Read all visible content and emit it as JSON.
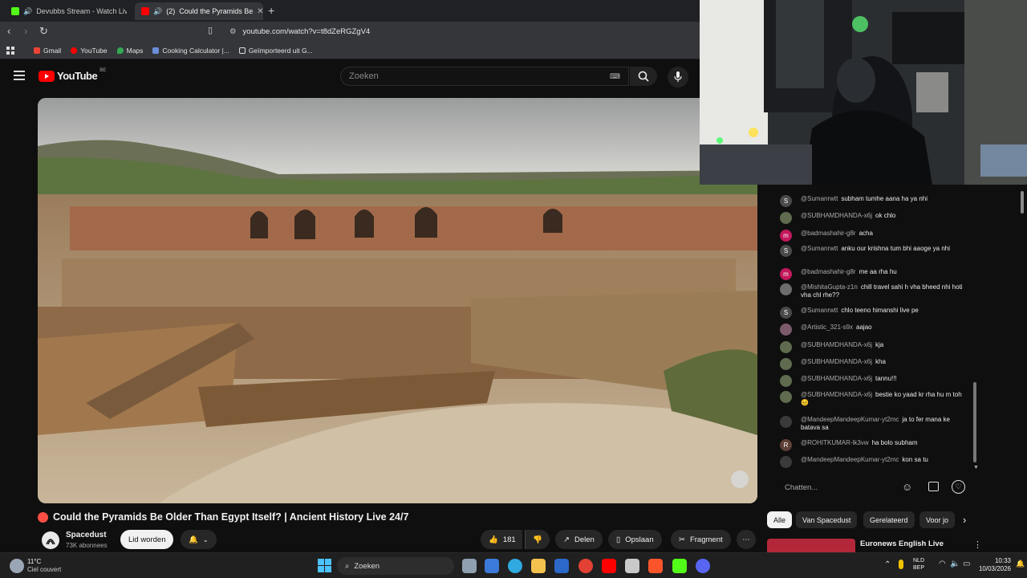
{
  "browser": {
    "tabs": [
      {
        "label": "Devubbs Stream - Watch Live on",
        "active": false
      },
      {
        "label": "(2)",
        "active": true,
        "title": "Could the Pyramids Be"
      }
    ],
    "new_tab": "+",
    "address": "youtube.com/watch?v=t8dZeRGZgV4",
    "bookmarks": [
      "Gmail",
      "YouTube",
      "Maps",
      "Cooking Calculator |...",
      "Geïmporteerd uit G..."
    ]
  },
  "youtube": {
    "logo_text": "YouTube",
    "region": "BE",
    "search_placeholder": "Zoeken"
  },
  "video": {
    "title": "Could the Pyramids Be Older Than Egypt Itself? | Ancient History Live 24/7",
    "channel": "Spacedust",
    "subscribers": "73K abonnees",
    "join_label": "Lid worden",
    "likes": "181",
    "share_label": "Delen",
    "save_label": "Opslaan",
    "clip_label": "Fragment"
  },
  "chat": {
    "messages": [
      {
        "author": "@Sumanrwtt",
        "text": "subham tumhe aana ha ya nhi",
        "avatar": "S",
        "color": "#4a4a4a"
      },
      {
        "author": "@SUBHAMDHANDA-x6j",
        "text": "ok chlo",
        "avatar": "",
        "color": "#5e6b4f"
      },
      {
        "author": "@badmashahir-g8r",
        "text": "acha",
        "avatar": "m",
        "color": "#c2185b"
      },
      {
        "author": "@Sumanrwtt",
        "text": "anku our krishna tum bhi aaoge ya nhi",
        "avatar": "S",
        "color": "#4a4a4a"
      },
      {
        "author": "@badmashahir-g8r",
        "text": "me aa rha hu",
        "avatar": "m",
        "color": "#c2185b"
      },
      {
        "author": "@MishitaGupta-z1n",
        "text": "chill travel sahi h vha bheed nhi hoti vha chl rhe??",
        "avatar": "",
        "color": "#6d6d6d"
      },
      {
        "author": "@Sumanrwtt",
        "text": "chlo teeno himanshi live pe",
        "avatar": "S",
        "color": "#4a4a4a"
      },
      {
        "author": "@Artistic_321-s9x",
        "text": "aajao",
        "avatar": "",
        "color": "#7b5a6a"
      },
      {
        "author": "@SUBHAMDHANDA-x6j",
        "text": "kja",
        "avatar": "",
        "color": "#5e6b4f"
      },
      {
        "author": "@SUBHAMDHANDA-x6j",
        "text": "kha",
        "avatar": "",
        "color": "#5e6b4f"
      },
      {
        "author": "@SUBHAMDHANDA-x6j",
        "text": "tannu!!!",
        "avatar": "",
        "color": "#5e6b4f"
      },
      {
        "author": "@SUBHAMDHANDA-x6j",
        "text": "bestie ko yaad kr rha hu m toh 😣",
        "avatar": "",
        "color": "#5e6b4f"
      },
      {
        "author": "@MandeepMandeepKumar-yt2mc",
        "text": "ja to fer mana ke batava sa",
        "avatar": "",
        "color": "#3a3a3a"
      },
      {
        "author": "@ROHITKUMAR-lk3vw",
        "text": "ha bolo subham",
        "avatar": "R",
        "color": "#5d4037"
      },
      {
        "author": "@MandeepMandeepKumar-yt2mc",
        "text": "kon sa tu",
        "avatar": "",
        "color": "#3a3a3a"
      }
    ],
    "input_placeholder": "Chatten..."
  },
  "chips": [
    "Alle",
    "Van Spacedust",
    "Gerelateerd",
    "Voor jo"
  ],
  "recommendation": {
    "title": "Euronews English Live"
  },
  "taskbar": {
    "weather_temp": "11°C",
    "weather_text": "Ciel couvert",
    "search_label": "Zoeken",
    "lang": "NLD",
    "lang_sub": "BEP",
    "time": "10:33",
    "date": "10/03/2026"
  },
  "colors": {
    "accent_red": "#ff0000",
    "live_red": "#ff4e45",
    "bg": "#0f0f0f"
  }
}
